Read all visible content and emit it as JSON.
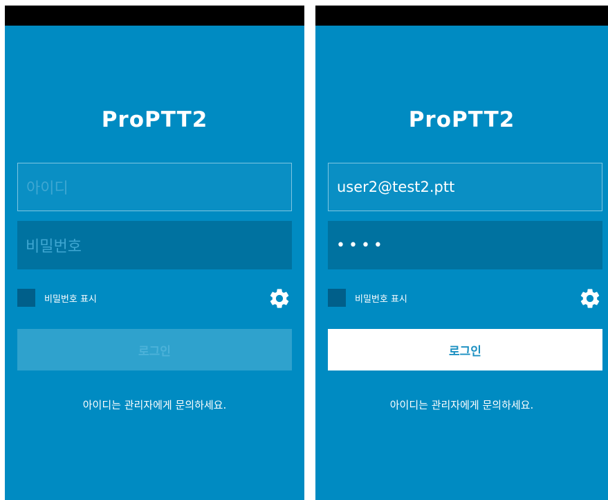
{
  "screens": [
    {
      "state": "empty",
      "app_title": "ProPTT2",
      "id_field": {
        "value": "",
        "placeholder": "아이디"
      },
      "password_field": {
        "value": "",
        "placeholder": "비밀번호"
      },
      "show_password_label": "비밀번호 표시",
      "login_button_label": "로그인",
      "login_button_enabled": false,
      "help_text": "아이디는 관리자에게 문의하세요."
    },
    {
      "state": "filled",
      "app_title": "ProPTT2",
      "id_field": {
        "value": "user2@test2.ptt",
        "placeholder": "아이디"
      },
      "password_field": {
        "value": "••••",
        "placeholder": "비밀번호"
      },
      "show_password_label": "비밀번호 표시",
      "login_button_label": "로그인",
      "login_button_enabled": true,
      "help_text": "아이디는 관리자에게 문의하세요."
    }
  ],
  "icons": {
    "settings": "gear-icon"
  },
  "colors": {
    "background": "#008bc2",
    "status_bar": "#000000",
    "id_field_border": "#7fc6e2",
    "password_field_bg": "#0072a0",
    "checkbox": "#005f8a",
    "button_disabled": "#2fa2cd",
    "button_enabled": "#ffffff",
    "button_enabled_text": "#1a8fc1"
  }
}
